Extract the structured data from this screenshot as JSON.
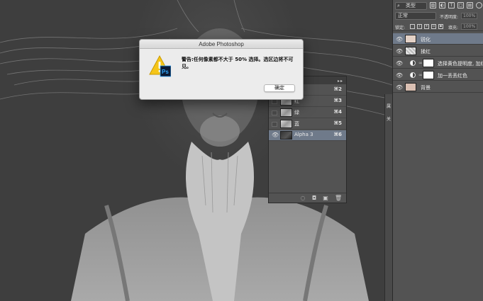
{
  "dialog": {
    "title": "Adobe Photoshop",
    "message": "警告:任何像素都不大于 50% 选择。选区边将不可见。",
    "ok_label": "确定",
    "ps_badge": "Ps",
    "icon": "warning-icon"
  },
  "channels_panel": {
    "rows": [
      {
        "name": "",
        "key": "⌘2"
      },
      {
        "name": "红",
        "key": "⌘3"
      },
      {
        "name": "绿",
        "key": "⌘4"
      },
      {
        "name": "蓝",
        "key": "⌘5"
      },
      {
        "name": "Alpha 3",
        "key": "⌘6",
        "selected": true
      }
    ],
    "menu_glyph": "▸▸",
    "bottom_icons": [
      "load-selection-icon",
      "save-selection-icon",
      "new-channel-icon",
      "delete-icon"
    ]
  },
  "mini_dock": {
    "labels": [
      "属",
      "关"
    ]
  },
  "layers_panel": {
    "kind_filter": "类型",
    "blend_mode": "正常",
    "opacity_label": "不透明度:",
    "opacity_value": "100%",
    "lock_label": "锁定:",
    "fill_label": "填充:",
    "fill_value": "100%",
    "layers": [
      {
        "name": "锐化",
        "selected": true
      },
      {
        "name": "揉红"
      },
      {
        "name": "选择黄色提明度, 加红",
        "type": "adjustment"
      },
      {
        "name": "加一丢丢红色",
        "type": "adjustment"
      },
      {
        "name": "背景"
      }
    ]
  },
  "colors": {
    "panel_bg": "#535353",
    "selection": "#6f7a8a",
    "dialog_bg": "#ececec",
    "warning_yellow": "#f5c518",
    "ps_blue": "#1a2a4a"
  }
}
